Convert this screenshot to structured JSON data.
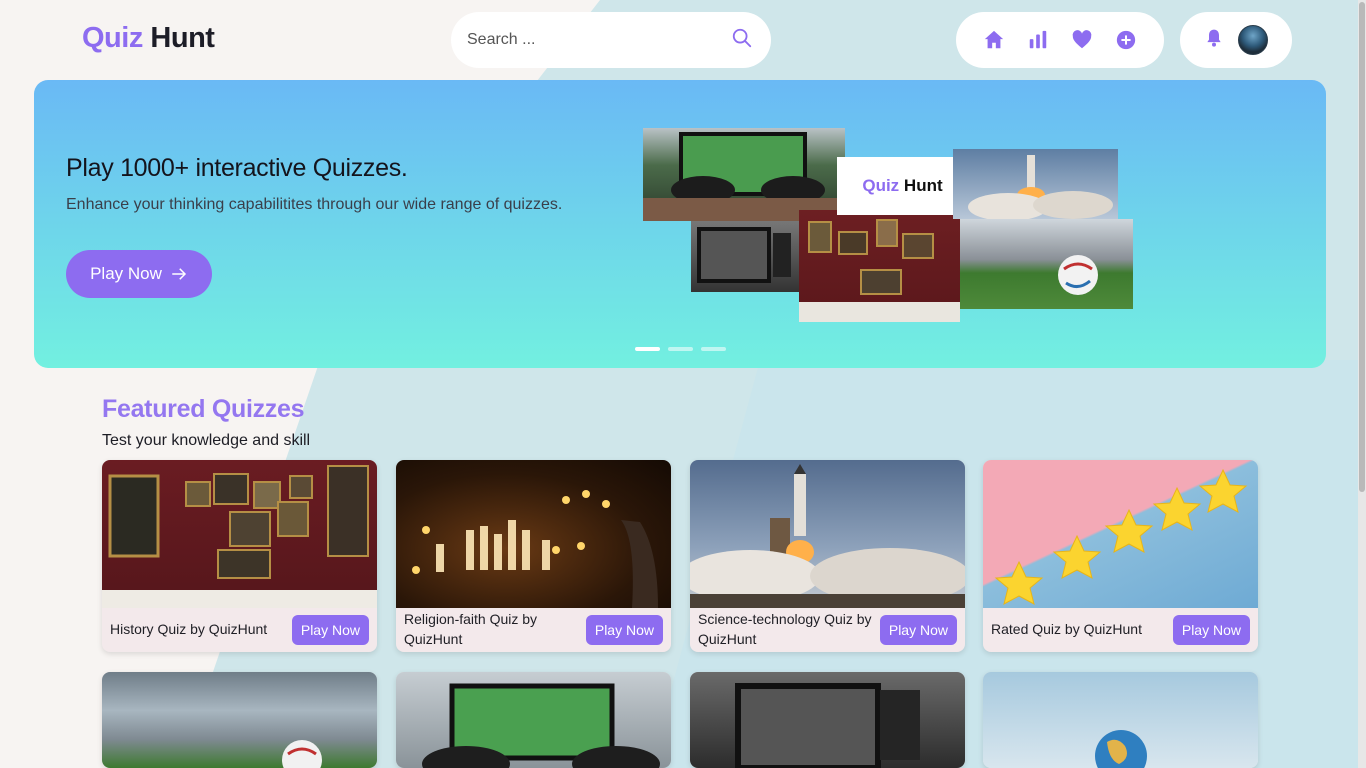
{
  "brand": {
    "quiz": "Quiz",
    "hunt": "Hunt"
  },
  "search": {
    "placeholder": "Search ..."
  },
  "nav": {
    "icons": [
      "home-icon",
      "stats-icon",
      "heart-icon",
      "add-circle-icon"
    ],
    "accent": "#8d6cf0"
  },
  "user": {
    "icons": [
      "bell-icon",
      "avatar"
    ]
  },
  "hero": {
    "title": "Play 1000+ interactive Quizzes.",
    "subtitle": "Enhance your thinking capabilitites through our wide range of quizzes.",
    "cta_label": "Play Now",
    "logo_quiz": "Quiz",
    "logo_hunt": "Hunt",
    "slides_count": 3,
    "active_slide": 1
  },
  "featured": {
    "title": "Featured Quizzes",
    "subtitle": "Test your knowledge and skill",
    "cards": [
      {
        "title": "History Quiz by QuizHunt",
        "button": "Play Now",
        "image": "museum-gallery"
      },
      {
        "title": "Religion-faith Quiz by QuizHunt",
        "button": "Play Now",
        "image": "candles-prayer"
      },
      {
        "title": "Science-technology Quiz by QuizHunt",
        "button": "Play Now",
        "image": "rocket-launch"
      },
      {
        "title": "Rated Quiz by QuizHunt",
        "button": "Play Now",
        "image": "gold-stars"
      }
    ],
    "more_cards": [
      {
        "image": "stadium-football"
      },
      {
        "image": "gaming-controllers"
      },
      {
        "image": "vintage-tv-river"
      },
      {
        "image": "globe-hands"
      }
    ]
  },
  "colors": {
    "accent": "#8d6cf0",
    "hero_top": "#6ab9f5",
    "hero_bottom": "#72f0e0"
  }
}
